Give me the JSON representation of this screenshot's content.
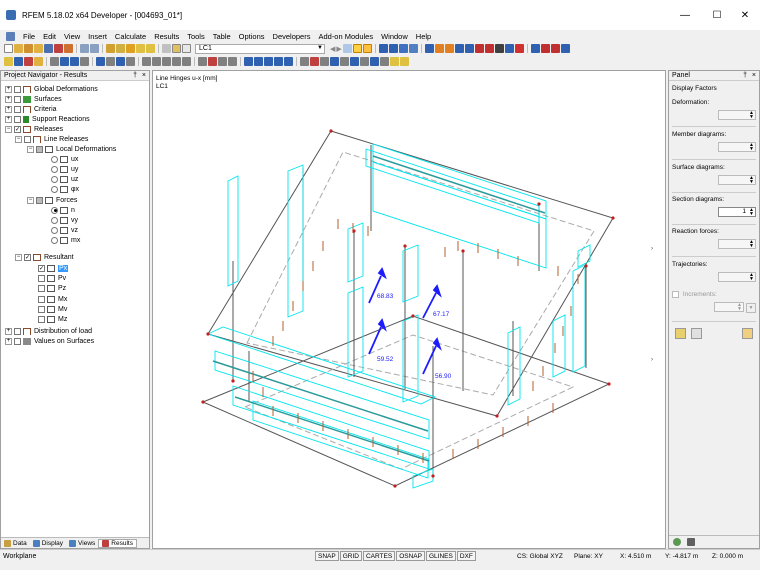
{
  "window": {
    "title": "RFEM 5.18.02 x64 Developer - [004693_01*]"
  },
  "menu": [
    "File",
    "Edit",
    "View",
    "Insert",
    "Calculate",
    "Results",
    "Tools",
    "Table",
    "Options",
    "Developers",
    "Add-on Modules",
    "Window",
    "Help"
  ],
  "toolbar": {
    "load_case": "LC1"
  },
  "navigator": {
    "title": "Project Navigator - Results",
    "items": {
      "global_deformations": "Global Deformations",
      "surfaces": "Surfaces",
      "criteria": "Criteria",
      "support_reactions": "Support Reactions",
      "releases": "Releases",
      "line_releases": "Line Releases",
      "local_deformations": "Local Deformations",
      "ux": "ux",
      "uy": "uy",
      "uz": "uz",
      "phix": "φx",
      "forces": "Forces",
      "n": "n",
      "vy": "vy",
      "vz": "vz",
      "mx": "mx",
      "resultant": "Resultant",
      "px": "Px",
      "pv": "Pv",
      "pz": "Pz",
      "mx2": "Mx",
      "mv": "Mv",
      "mz": "Mz",
      "distribution_of_load": "Distribution of load",
      "values_on_surfaces": "Values on Surfaces"
    },
    "tabs": [
      "Data",
      "Display",
      "Views",
      "Results"
    ]
  },
  "view": {
    "line1": "Line Hinges u-x [mm]",
    "line2": "LC1",
    "values": {
      "v1": "68.83",
      "v2": "67.17",
      "v3": "59.52",
      "v4": "56.90"
    }
  },
  "panel": {
    "title": "Panel",
    "section": "Display Factors",
    "deformation_label": "Deformation:",
    "member_diagrams_label": "Member diagrams:",
    "surface_diagrams_label": "Surface diagrams:",
    "section_diagrams_label": "Section diagrams:",
    "section_diagrams_value": "1",
    "reaction_forces_label": "Reaction forces:",
    "trajectories_label": "Trajectories:",
    "increments_label": "Increments:"
  },
  "status": {
    "workplane": "Workplane",
    "toggles": [
      "SNAP",
      "GRID",
      "CARTES",
      "OSNAP",
      "GLINES",
      "DXF"
    ],
    "cs": "CS: Global XYZ",
    "plane": "Plane: XY",
    "x": "X:  4.510 m",
    "y": "Y:  -4.817 m",
    "z": "Z:  0.000 m"
  },
  "colors": {
    "accent": "#3399ff",
    "hinge": "#00e5ee",
    "arrow": "#1c1cff"
  }
}
